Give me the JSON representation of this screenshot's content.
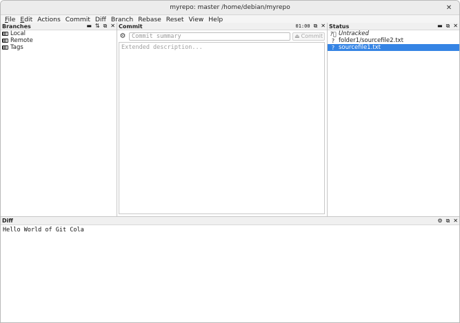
{
  "window": {
    "title": "myrepo: master /home/debian/myrepo"
  },
  "menu": [
    {
      "label": "File",
      "accel": "F",
      "rest": "ile"
    },
    {
      "label": "Edit",
      "accel": "E",
      "rest": "dit"
    },
    {
      "label": "Actions"
    },
    {
      "label": "Commit"
    },
    {
      "label": "Diff"
    },
    {
      "label": "Branch"
    },
    {
      "label": "Rebase"
    },
    {
      "label": "Reset"
    },
    {
      "label": "View"
    },
    {
      "label": "Help"
    }
  ],
  "branches": {
    "title": "Branches",
    "items": [
      "Local",
      "Remote",
      "Tags"
    ]
  },
  "commit": {
    "title": "Commit",
    "time": "01:00",
    "summary_placeholder": "Commit summary",
    "button_label": "Commit",
    "description_placeholder": "Extended description..."
  },
  "status": {
    "title": "Status",
    "group_label": "Untracked",
    "files": [
      "folder1/sourcefile2.txt",
      "sourcefile1.txt"
    ],
    "selected_index": 1
  },
  "diff": {
    "title": "Diff",
    "content": "Hello World of Git Cola"
  },
  "colors": {
    "selection": "#3584e4"
  }
}
